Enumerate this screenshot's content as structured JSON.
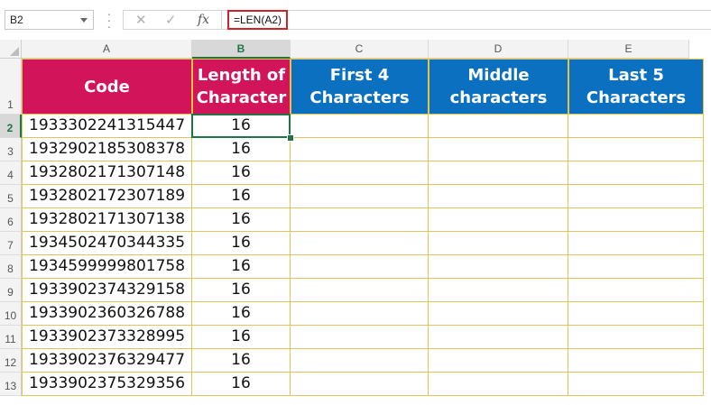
{
  "formula_bar": {
    "name_box": "B2",
    "cancel_icon": "✕",
    "enter_icon": "✓",
    "fx_label": "fx",
    "formula": "=LEN(A2)"
  },
  "columns": [
    {
      "letter": "A"
    },
    {
      "letter": "B"
    },
    {
      "letter": "C"
    },
    {
      "letter": "D"
    },
    {
      "letter": "E"
    }
  ],
  "header_row": {
    "row_number": "1",
    "cells": [
      "Code",
      "Length of Character",
      "First 4 Characters",
      "Middle characters",
      "Last 5 Characters"
    ],
    "colors": [
      "#d2145a",
      "#d2145a",
      "#0b70bf",
      "#0b70bf",
      "#0b70bf"
    ]
  },
  "rows": [
    {
      "row": "2",
      "code": "1933302241315447",
      "length": "16"
    },
    {
      "row": "3",
      "code": "1932902185308378",
      "length": "16"
    },
    {
      "row": "4",
      "code": "1932802171307148",
      "length": "16"
    },
    {
      "row": "5",
      "code": "1932802172307189",
      "length": "16"
    },
    {
      "row": "6",
      "code": "1932802171307138",
      "length": "16"
    },
    {
      "row": "7",
      "code": "1934502470344335",
      "length": "16"
    },
    {
      "row": "8",
      "code": "1934599999801758",
      "length": "16"
    },
    {
      "row": "9",
      "code": "1933902374329158",
      "length": "16"
    },
    {
      "row": "10",
      "code": "1933902360326788",
      "length": "16"
    },
    {
      "row": "11",
      "code": "1933902373328995",
      "length": "16"
    },
    {
      "row": "12",
      "code": "1933902376329477",
      "length": "16"
    },
    {
      "row": "13",
      "code": "1933902375329356",
      "length": "16"
    }
  ],
  "selected_cell": "B2"
}
